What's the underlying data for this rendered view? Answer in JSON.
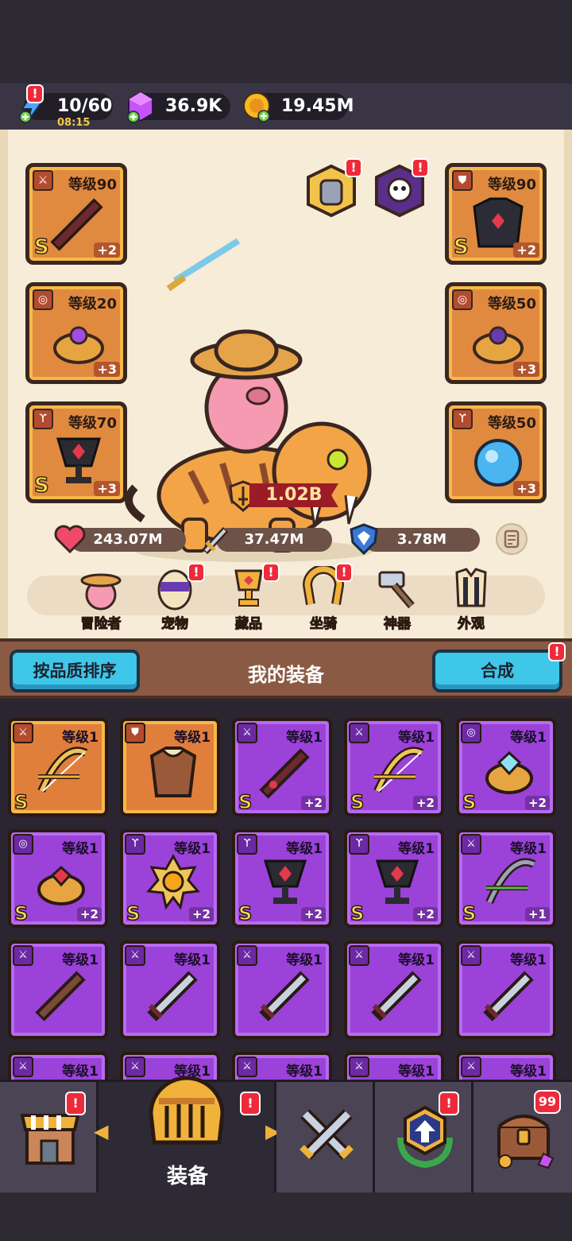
{
  "resources": {
    "energy": {
      "value": "10/60",
      "timer": "08:15",
      "icon": "lightning-icon",
      "badge": "!"
    },
    "gems": {
      "value": "36.9K",
      "icon": "gem-icon"
    },
    "gold": {
      "value": "19.45M",
      "icon": "gold-coin-icon"
    }
  },
  "equipped": {
    "left": [
      {
        "level": "等级90",
        "plus": "+2",
        "rank": "S",
        "slot_icon": "sword-icon",
        "item": "dark-sword"
      },
      {
        "level": "等级20",
        "plus": "+3",
        "rank": "",
        "slot_icon": "ring-icon",
        "item": "purple-ring"
      },
      {
        "level": "等级70",
        "plus": "+3",
        "rank": "S",
        "slot_icon": "necklace-icon",
        "item": "black-grail"
      }
    ],
    "right": [
      {
        "level": "等级90",
        "plus": "+2",
        "rank": "S",
        "slot_icon": "armor-icon",
        "item": "dark-armor"
      },
      {
        "level": "等级50",
        "plus": "+3",
        "rank": "",
        "slot_icon": "ring-icon",
        "item": "purple-ring"
      },
      {
        "level": "等级50",
        "plus": "+3",
        "rank": "",
        "slot_icon": "necklace-icon",
        "item": "blue-orb"
      }
    ],
    "top_badges": [
      "!",
      "!"
    ]
  },
  "combat_power": "1.02B",
  "stats": {
    "hp": "243.07M",
    "attack": "37.47M",
    "defense": "3.78M"
  },
  "menu": [
    {
      "label": "冒险者",
      "icon": "adventurer-icon",
      "badge": ""
    },
    {
      "label": "宠物",
      "icon": "pet-egg-icon",
      "badge": "!"
    },
    {
      "label": "藏品",
      "icon": "trophy-icon",
      "badge": "!"
    },
    {
      "label": "坐骑",
      "icon": "horseshoe-icon",
      "badge": "!"
    },
    {
      "label": "神器",
      "icon": "hammer-icon",
      "badge": ""
    },
    {
      "label": "外观",
      "icon": "outfit-icon",
      "badge": ""
    }
  ],
  "equipment_header": {
    "sort_button": "按品质排序",
    "title": "我的装备",
    "merge_button": "合成",
    "merge_badge": "!"
  },
  "inventory": [
    {
      "level": "等级1",
      "plus": "",
      "rank": "S",
      "quality": "orange",
      "slot_icon": "sword-icon",
      "item": "golden-bow"
    },
    {
      "level": "等级1",
      "plus": "",
      "rank": "",
      "quality": "orange",
      "slot_icon": "armor-icon",
      "item": "fur-armor"
    },
    {
      "level": "等级1",
      "plus": "+2",
      "rank": "S",
      "quality": "purple",
      "slot_icon": "sword-icon",
      "item": "dark-sword"
    },
    {
      "level": "等级1",
      "plus": "+2",
      "rank": "S",
      "quality": "purple",
      "slot_icon": "sword-icon",
      "item": "golden-bow"
    },
    {
      "level": "等级1",
      "plus": "+2",
      "rank": "S",
      "quality": "purple",
      "slot_icon": "ring-icon",
      "item": "crystal-ring"
    },
    {
      "level": "等级1",
      "plus": "+2",
      "rank": "S",
      "quality": "purple",
      "slot_icon": "ring-icon",
      "item": "ruby-ring"
    },
    {
      "level": "等级1",
      "plus": "+2",
      "rank": "S",
      "quality": "purple",
      "slot_icon": "necklace-icon",
      "item": "sun-amulet"
    },
    {
      "level": "等级1",
      "plus": "+2",
      "rank": "S",
      "quality": "purple",
      "slot_icon": "necklace-icon",
      "item": "black-grail"
    },
    {
      "level": "等级1",
      "plus": "+2",
      "rank": "S",
      "quality": "purple",
      "slot_icon": "necklace-icon",
      "item": "black-grail"
    },
    {
      "level": "等级1",
      "plus": "+1",
      "rank": "S",
      "quality": "purple",
      "slot_icon": "sword-icon",
      "item": "green-bow"
    },
    {
      "level": "等级1",
      "plus": "",
      "rank": "",
      "quality": "purple",
      "slot_icon": "sword-icon",
      "item": "wood-sword"
    },
    {
      "level": "等级1",
      "plus": "",
      "rank": "",
      "quality": "purple",
      "slot_icon": "sword-icon",
      "item": "steel-sword"
    },
    {
      "level": "等级1",
      "plus": "",
      "rank": "",
      "quality": "purple",
      "slot_icon": "sword-icon",
      "item": "steel-sword"
    },
    {
      "level": "等级1",
      "plus": "",
      "rank": "",
      "quality": "purple",
      "slot_icon": "sword-icon",
      "item": "steel-sword"
    },
    {
      "level": "等级1",
      "plus": "",
      "rank": "",
      "quality": "purple",
      "slot_icon": "sword-icon",
      "item": "steel-sword"
    },
    {
      "level": "等级1",
      "plus": "",
      "rank": "",
      "quality": "purple",
      "slot_icon": "sword-icon",
      "item": ""
    },
    {
      "level": "等级1",
      "plus": "",
      "rank": "",
      "quality": "purple",
      "slot_icon": "sword-icon",
      "item": ""
    },
    {
      "level": "等级1",
      "plus": "",
      "rank": "",
      "quality": "purple",
      "slot_icon": "sword-icon",
      "item": ""
    },
    {
      "level": "等级1",
      "plus": "",
      "rank": "",
      "quality": "purple",
      "slot_icon": "sword-icon",
      "item": ""
    },
    {
      "level": "等级1",
      "plus": "",
      "rank": "",
      "quality": "purple",
      "slot_icon": "sword-icon",
      "item": ""
    }
  ],
  "bottom_nav": [
    {
      "id": "shop",
      "label": "",
      "icon": "shop-icon",
      "badge": "!"
    },
    {
      "id": "equipment",
      "label": "装备",
      "icon": "helmet-icon",
      "badge": "!",
      "active": true
    },
    {
      "id": "battle",
      "label": "",
      "icon": "crossed-swords-icon",
      "badge": ""
    },
    {
      "id": "upgrade",
      "label": "",
      "icon": "upgrade-emblem-icon",
      "badge": "!"
    },
    {
      "id": "chest",
      "label": "",
      "icon": "treasure-chest-icon",
      "badge": "99"
    }
  ],
  "colors": {
    "orange_quality": "#e07f3b",
    "purple_quality": "#9b42d9",
    "accent_blue": "#3ec7e8",
    "badge_red": "#ee2a3a"
  }
}
